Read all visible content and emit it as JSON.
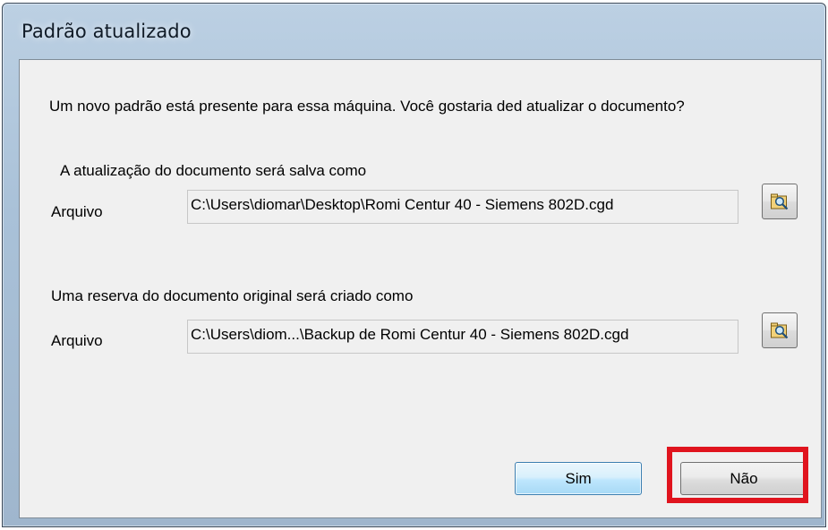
{
  "dialog": {
    "title": "Padrão atualizado",
    "prompt": "Um novo padrão está presente para essa máquina. Você gostaria ded atualizar o documento?",
    "update_section": {
      "heading": "A atualização do documento será salva como",
      "file_label": "Arquivo",
      "file_path": "C:\\Users\\diomar\\Desktop\\Romi Centur 40 - Siemens 802D.cgd",
      "browse_icon": "folder-search-icon"
    },
    "backup_section": {
      "heading": "Uma reserva do documento original será criado como",
      "file_label": "Arquivo",
      "file_path": "C:\\Users\\diom...\\Backup de Romi Centur 40 - Siemens 802D.cgd",
      "browse_icon": "folder-search-icon"
    },
    "buttons": {
      "yes_label": "Sim",
      "no_label": "Não"
    },
    "highlight_color": "#e0141e"
  }
}
